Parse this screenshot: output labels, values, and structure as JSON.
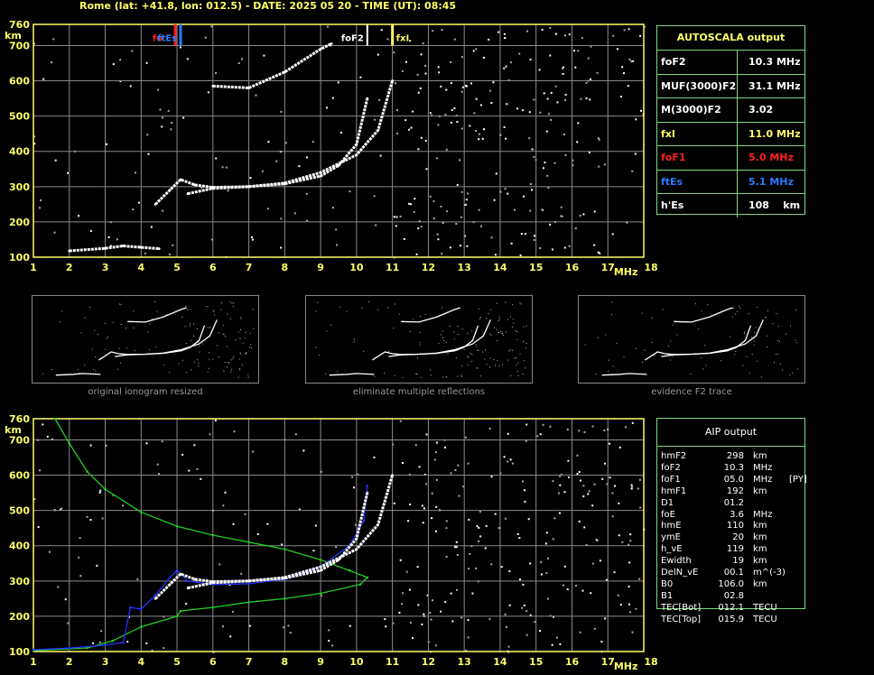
{
  "header": "Rome (lat: +41.8, lon: 012.5) - DATE: 2025 05 20 - TIME (UT): 08:45",
  "chart_data": [
    {
      "type": "scatter",
      "xlabel": "MHz",
      "ylabel": "km",
      "xlim": [
        1,
        18
      ],
      "ylim": [
        100,
        760
      ],
      "x_ticks": [
        "1",
        "2",
        "3",
        "4",
        "5",
        "6",
        "7",
        "8",
        "9",
        "10",
        "11",
        "12",
        "13",
        "14",
        "15",
        "16",
        "17",
        "18"
      ],
      "y_ticks": [
        "100",
        "200",
        "300",
        "400",
        "500",
        "600",
        "700",
        "760"
      ],
      "grid": true,
      "markers": [
        {
          "label": "fo",
          "x": 4.95,
          "color": "#ff2020"
        },
        {
          "label": "ftEs",
          "x": 5.1,
          "color": "#2a7bff"
        },
        {
          "label": "foF2",
          "x": 10.3,
          "color": "#ffffff"
        },
        {
          "label": "fxI",
          "x": 11.0,
          "color": "#ffff66"
        }
      ],
      "series": [
        {
          "values": [
            [
              2.0,
              118
            ],
            [
              3.0,
              125
            ],
            [
              3.5,
              132
            ],
            [
              4.0,
              128
            ],
            [
              4.5,
              124
            ]
          ]
        },
        {
          "values": [
            [
              4.4,
              250
            ],
            [
              4.8,
              290
            ],
            [
              5.1,
              320
            ],
            [
              5.5,
              305
            ],
            [
              6.0,
              298
            ],
            [
              7.0,
              300
            ],
            [
              8.0,
              308
            ],
            [
              9.0,
              330
            ],
            [
              9.5,
              360
            ],
            [
              10.0,
              420
            ],
            [
              10.3,
              550
            ]
          ]
        },
        {
          "values": [
            [
              5.3,
              280
            ],
            [
              6.0,
              295
            ],
            [
              7.0,
              300
            ],
            [
              8.0,
              310
            ],
            [
              9.0,
              340
            ],
            [
              10.0,
              390
            ],
            [
              10.6,
              460
            ],
            [
              11.0,
              600
            ]
          ]
        },
        {
          "values": [
            [
              6.0,
              585
            ],
            [
              7.0,
              580
            ],
            [
              8.0,
              625
            ],
            [
              9.0,
              690
            ],
            [
              9.3,
              705
            ]
          ]
        }
      ]
    },
    {
      "type": "line",
      "xlabel": "MHz",
      "ylabel": "km",
      "xlim": [
        1,
        18
      ],
      "ylim": [
        100,
        760
      ],
      "x_ticks": [
        "1",
        "2",
        "3",
        "4",
        "5",
        "6",
        "7",
        "8",
        "9",
        "10",
        "11",
        "12",
        "13",
        "14",
        "15",
        "16",
        "17",
        "18"
      ],
      "y_ticks": [
        "100",
        "200",
        "300",
        "400",
        "500",
        "600",
        "700",
        "760"
      ],
      "grid": true,
      "series": [
        {
          "color": "#22cc22",
          "values": [
            [
              1.6,
              760
            ],
            [
              2.0,
              690
            ],
            [
              2.5,
              610
            ],
            [
              3.0,
              560
            ],
            [
              4.0,
              495
            ],
            [
              5.0,
              455
            ],
            [
              6.0,
              430
            ],
            [
              7.0,
              410
            ],
            [
              8.0,
              390
            ],
            [
              9.0,
              360
            ],
            [
              9.8,
              330
            ],
            [
              10.3,
              310
            ],
            [
              10.1,
              290
            ],
            [
              9.0,
              265
            ],
            [
              8.0,
              250
            ],
            [
              7.0,
              240
            ],
            [
              6.0,
              225
            ],
            [
              5.1,
              215
            ],
            [
              5.0,
              200
            ],
            [
              4.0,
              170
            ],
            [
              3.2,
              130
            ],
            [
              2.5,
              110
            ],
            [
              1.0,
              103
            ]
          ]
        },
        {
          "color": "#2233ff",
          "values": [
            [
              1.0,
              105
            ],
            [
              2.0,
              110
            ],
            [
              3.0,
              118
            ],
            [
              3.5,
              125
            ],
            [
              3.7,
              225
            ],
            [
              4.0,
              220
            ],
            [
              4.4,
              260
            ],
            [
              4.8,
              310
            ],
            [
              5.0,
              330
            ],
            [
              5.3,
              300
            ],
            [
              6.0,
              290
            ],
            [
              7.0,
              292
            ],
            [
              8.0,
              305
            ],
            [
              9.0,
              340
            ],
            [
              9.8,
              400
            ],
            [
              10.2,
              470
            ],
            [
              10.3,
              570
            ]
          ]
        },
        {
          "color": "#ffffff",
          "values": [
            [
              4.4,
              250
            ],
            [
              4.8,
              290
            ],
            [
              5.1,
              320
            ],
            [
              5.5,
              305
            ],
            [
              6.0,
              298
            ],
            [
              7.0,
              300
            ],
            [
              8.0,
              308
            ],
            [
              9.0,
              330
            ],
            [
              9.5,
              360
            ],
            [
              10.0,
              420
            ],
            [
              10.3,
              550
            ]
          ]
        },
        {
          "color": "#ffffff",
          "values": [
            [
              5.3,
              280
            ],
            [
              6.0,
              295
            ],
            [
              7.0,
              300
            ],
            [
              8.0,
              310
            ],
            [
              9.0,
              340
            ],
            [
              10.0,
              390
            ],
            [
              10.6,
              460
            ],
            [
              11.0,
              600
            ]
          ]
        }
      ]
    }
  ],
  "autoscala": {
    "title": "AUTOSCALA output",
    "rows": [
      {
        "k": "foF2",
        "v": "10.3 MHz",
        "color": "#ffffff"
      },
      {
        "k": "MUF(3000)F2",
        "v": "31.1 MHz",
        "color": "#ffffff"
      },
      {
        "k": "M(3000)F2",
        "v": "3.02",
        "color": "#ffffff"
      },
      {
        "k": "fxI",
        "v": "11.0 MHz",
        "color": "#ffff66"
      },
      {
        "k": "foF1",
        "v": "5.0 MHz",
        "color": "#ff2020"
      },
      {
        "k": "ftEs",
        "v": "5.1 MHz",
        "color": "#2a7bff"
      },
      {
        "k": "h'Es",
        "v": "108    km",
        "color": "#ffffff"
      }
    ]
  },
  "aip": {
    "title": "AIP output",
    "rows": [
      [
        "hmF2",
        "298",
        "km",
        ""
      ],
      [
        "foF2",
        "10.3",
        "MHz",
        ""
      ],
      [
        "foF1",
        "05.0",
        "MHz",
        "[PY]"
      ],
      [
        "hmF1",
        "192",
        "km",
        ""
      ],
      [
        "D1",
        "01.2",
        "",
        ""
      ],
      [
        "foE",
        "3.6",
        "MHz",
        ""
      ],
      [
        "hmE",
        "110",
        "km",
        ""
      ],
      [
        "ymE",
        "20",
        "km",
        ""
      ],
      [
        "h_vE",
        "119",
        "km",
        ""
      ],
      [
        "Ewidth",
        "19",
        "km",
        ""
      ],
      [
        "DelN_vE",
        "00.1",
        "m^(-3)",
        ""
      ],
      [
        "B0",
        "106.0",
        "km",
        ""
      ],
      [
        "B1",
        "02.8",
        "",
        ""
      ],
      [
        "TEC[Bot]",
        "012.1",
        "TECU",
        ""
      ],
      [
        "TEC[Top]",
        "015.9",
        "TECU",
        ""
      ]
    ]
  },
  "thumbs": [
    {
      "caption": "original ionogram resized"
    },
    {
      "caption": "eliminate multiple reflections"
    },
    {
      "caption": "evidence F2 trace"
    }
  ]
}
